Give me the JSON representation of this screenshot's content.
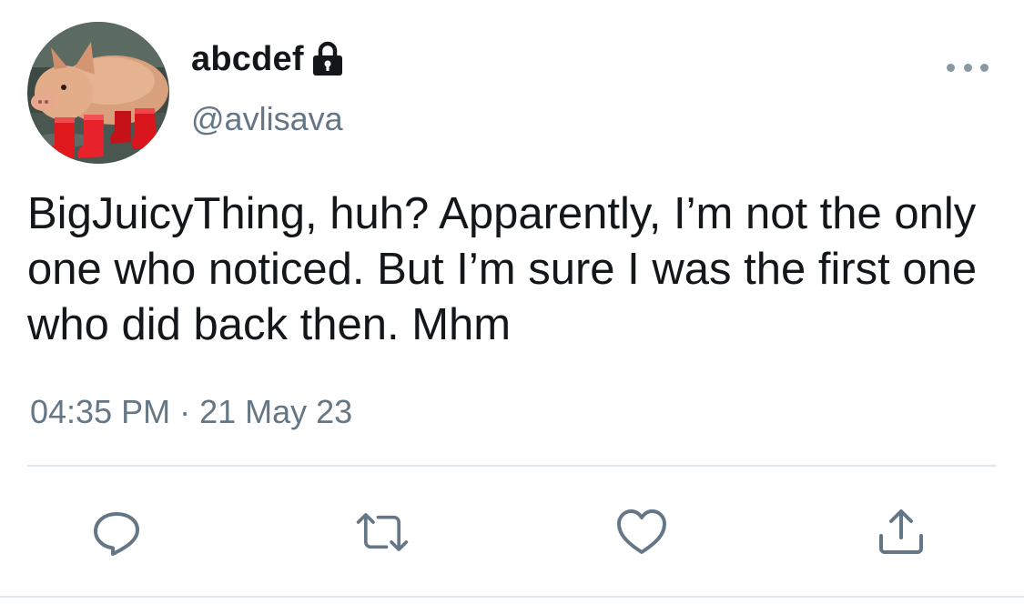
{
  "user": {
    "display_name": "abcdef",
    "handle": "@avlisava",
    "avatar_icon": "pig-in-red-boots-avatar",
    "protected_icon": "lock-icon"
  },
  "tweet": {
    "text": "BigJuicyThing, huh? Apparently, I’m not the only one who noticed. But I’m sure I was the first one who did back then. Mhm",
    "timestamp": "04:35 PM · 21 May 23"
  },
  "actions": [
    {
      "name": "reply",
      "icon": "reply-icon"
    },
    {
      "name": "retweet",
      "icon": "retweet-icon"
    },
    {
      "name": "like",
      "icon": "heart-icon"
    },
    {
      "name": "share",
      "icon": "share-icon"
    }
  ],
  "colors": {
    "text_primary": "#14171a",
    "text_secondary": "#657786",
    "icon": "#657786",
    "divider": "#e1e8ed"
  }
}
